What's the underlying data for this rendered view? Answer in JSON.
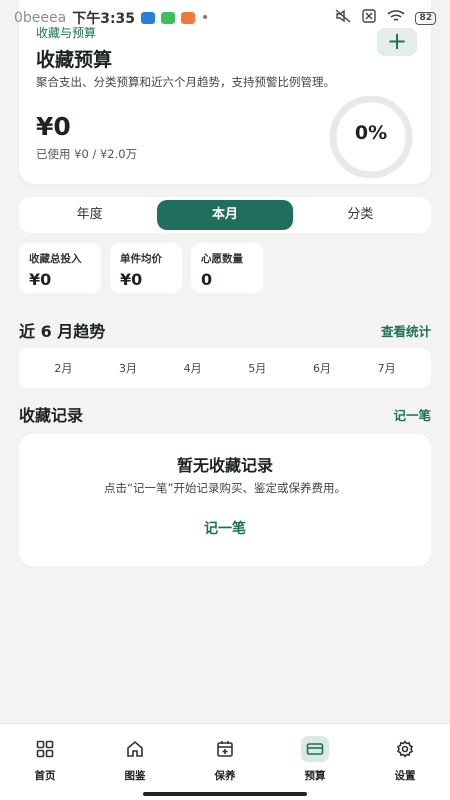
{
  "status_bar": {
    "app_label": "0beeea",
    "time": "下午3:35",
    "battery": "82"
  },
  "hero": {
    "subtitle": "收藏与预算",
    "title": "收藏预算",
    "description": "聚合支出、分类预算和近六个月趋势，支持预警比例管理。",
    "amount": "¥0",
    "used": "已使用 ¥0 / ¥2.0万",
    "percent_label": "0%",
    "progress": 0,
    "add_label": "+"
  },
  "tabs": [
    {
      "label": "年度",
      "active": false
    },
    {
      "label": "本月",
      "active": true
    },
    {
      "label": "分类",
      "active": false
    }
  ],
  "stats": [
    {
      "label": "收藏总投入",
      "value": "¥0"
    },
    {
      "label": "单件均价",
      "value": "¥0"
    },
    {
      "label": "心愿数量",
      "value": "0"
    }
  ],
  "trend": {
    "title": "近 6 月趋势",
    "link": "查看统计",
    "months": [
      "2月",
      "3月",
      "4月",
      "5月",
      "6月",
      "7月"
    ]
  },
  "records": {
    "title": "收藏记录",
    "link": "记一笔",
    "empty_title": "暂无收藏记录",
    "empty_desc": "点击“记一笔”开始记录购买、鉴定或保养费用。",
    "empty_action": "记一笔"
  },
  "nav": [
    {
      "label": "首页",
      "icon": "grid-icon",
      "active": false
    },
    {
      "label": "图鉴",
      "icon": "home-icon",
      "active": false
    },
    {
      "label": "保养",
      "icon": "calendar-icon",
      "active": false
    },
    {
      "label": "预算",
      "icon": "wallet-icon",
      "active": true
    },
    {
      "label": "设置",
      "icon": "gear-icon",
      "active": false
    }
  ],
  "colors": {
    "accent": "#1f6f5c",
    "background": "#f3f4f2",
    "ring_track": "#e8e9e8"
  }
}
